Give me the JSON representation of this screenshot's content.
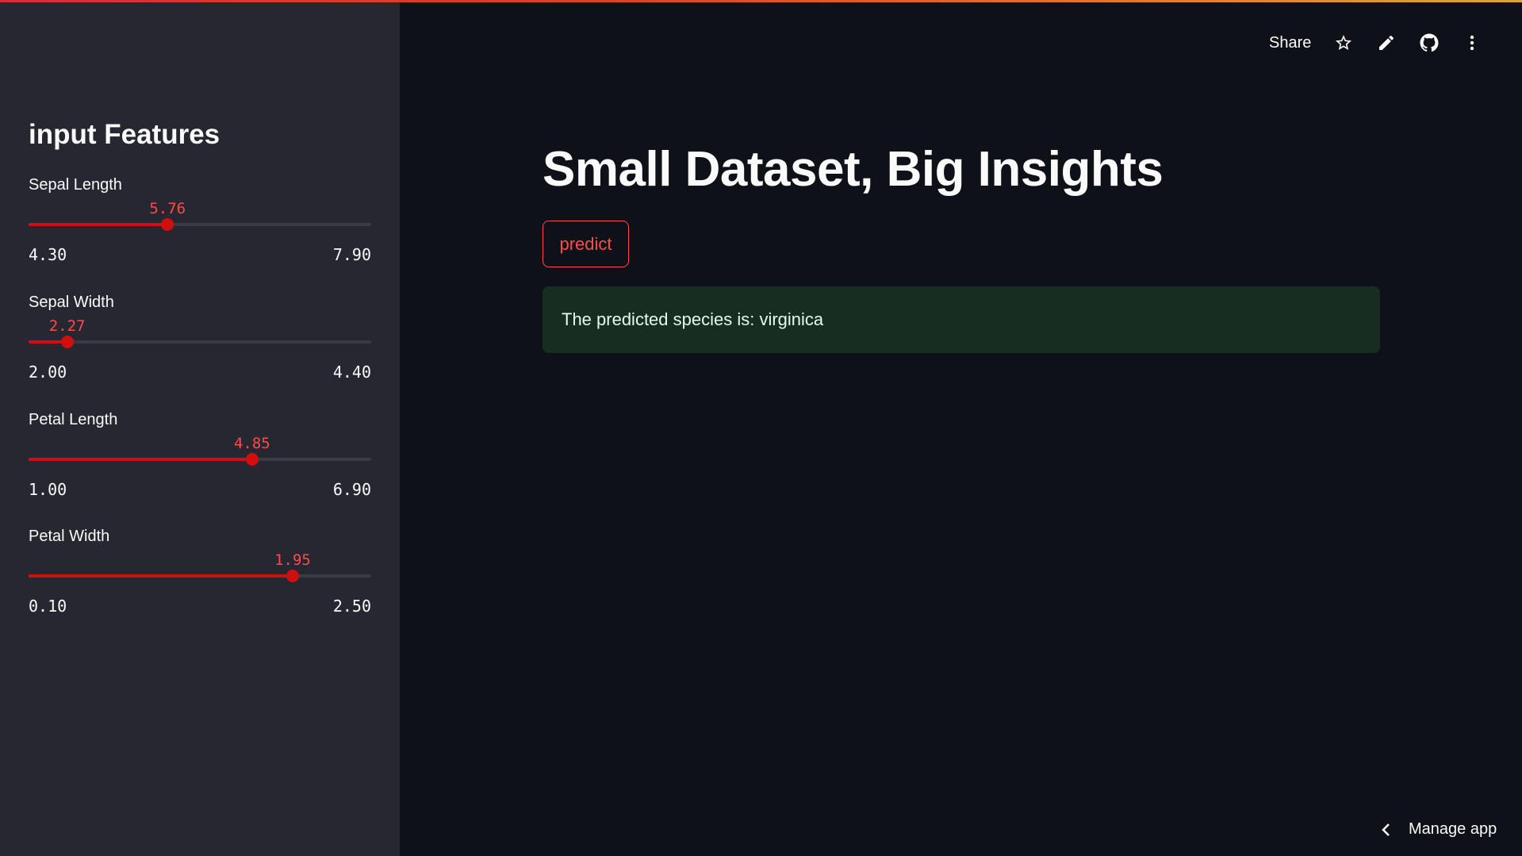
{
  "header": {
    "share_label": "Share",
    "icons": [
      "star-icon",
      "pencil-icon",
      "github-icon",
      "more-vertical-icon"
    ]
  },
  "sidebar": {
    "title": "input Features",
    "sliders": [
      {
        "label": "Sepal Length",
        "value": "5.76",
        "min": "4.30",
        "max": "7.90",
        "fraction": 0.4056
      },
      {
        "label": "Sepal Width",
        "value": "2.27",
        "min": "2.00",
        "max": "4.40",
        "fraction": 0.1125
      },
      {
        "label": "Petal Length",
        "value": "4.85",
        "min": "1.00",
        "max": "6.90",
        "fraction": 0.6525
      },
      {
        "label": "Petal Width",
        "value": "1.95",
        "min": "0.10",
        "max": "2.50",
        "fraction": 0.7708
      }
    ]
  },
  "main": {
    "title": "Small Dataset, Big Insights",
    "predict_label": "predict",
    "result_text": "The predicted species is: virginica"
  },
  "footer": {
    "manage_label": "Manage app"
  },
  "colors": {
    "accent": "#ff4b4b",
    "slider_fill": "#d10f0f",
    "success_bg": "#172d22",
    "success_text": "#dffde9"
  }
}
